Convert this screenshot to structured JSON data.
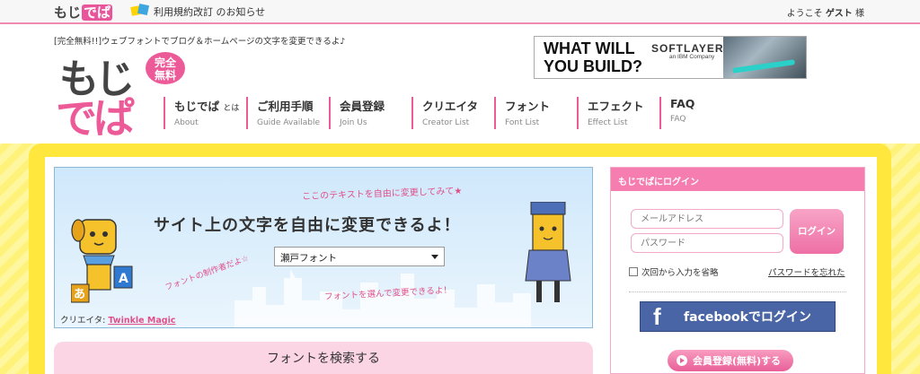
{
  "topbar": {
    "logo_text": "もじ",
    "logo_text_pink": "でぱ",
    "notice": "利用規約改訂 のお知らせ",
    "welcome_prefix": "ようこそ",
    "welcome_name": "ゲスト",
    "welcome_suffix": "様"
  },
  "header": {
    "tagline": "[完全無料!!]ウェブフォントでブログ＆ホームページの文字を変更できるよ♪",
    "logo_line1": "もじ",
    "logo_line2": "でぱ",
    "logo_badge_top": "完全",
    "logo_badge_bottom": "無料"
  },
  "ad": {
    "headline_1": "WHAT WILL",
    "headline_2": "YOU BUILD?",
    "brand": "SOFTLAYER",
    "brand_sub": "an IBM Company"
  },
  "nav": [
    {
      "jp": "もじでぱ",
      "jp_small": "とは",
      "en": "About"
    },
    {
      "jp": "ご利用手順",
      "jp_small": "",
      "en": "Guide Available"
    },
    {
      "jp": "会員登録",
      "jp_small": "",
      "en": "Join Us"
    },
    {
      "jp": "クリエイタ",
      "jp_small": "",
      "en": "Creator List"
    },
    {
      "jp": "フォント",
      "jp_small": "",
      "en": "Font List"
    },
    {
      "jp": "エフェクト",
      "jp_small": "",
      "en": "Effect List"
    },
    {
      "jp": "FAQ",
      "jp_small": "",
      "en": "FAQ"
    }
  ],
  "hero": {
    "headline": "サイト上の文字を自由に変更できるよ！",
    "note_top": "ここのテキストを自由に変更してみて★",
    "note_bottom": "フォントを選んで変更できるよ！",
    "note_left": "フォントの制作者だよ☆",
    "font_select_value": "瀬戸フォント",
    "credit_label": "クリエイタ:",
    "credit_name": "Twinkle Magic",
    "dog_tag": "あ",
    "bag_letter": "A"
  },
  "search": {
    "title": "フォントを検索する"
  },
  "login": {
    "heading": "もじでぱにログイン",
    "email_placeholder": "メールアドレス",
    "password_placeholder": "パスワード",
    "login_button": "ログイン",
    "remember_label": "次回から入力を省略",
    "forgot_link": "パスワードを忘れた",
    "facebook_button": "facebookでログイン",
    "facebook_glyph": "f",
    "register_button": "会員登録(無料)する"
  },
  "colors": {
    "brand_pink": "#ec5a98",
    "login_header": "#f57db0",
    "facebook_blue": "#4a65a6",
    "frame_yellow": "#ffe73d"
  }
}
